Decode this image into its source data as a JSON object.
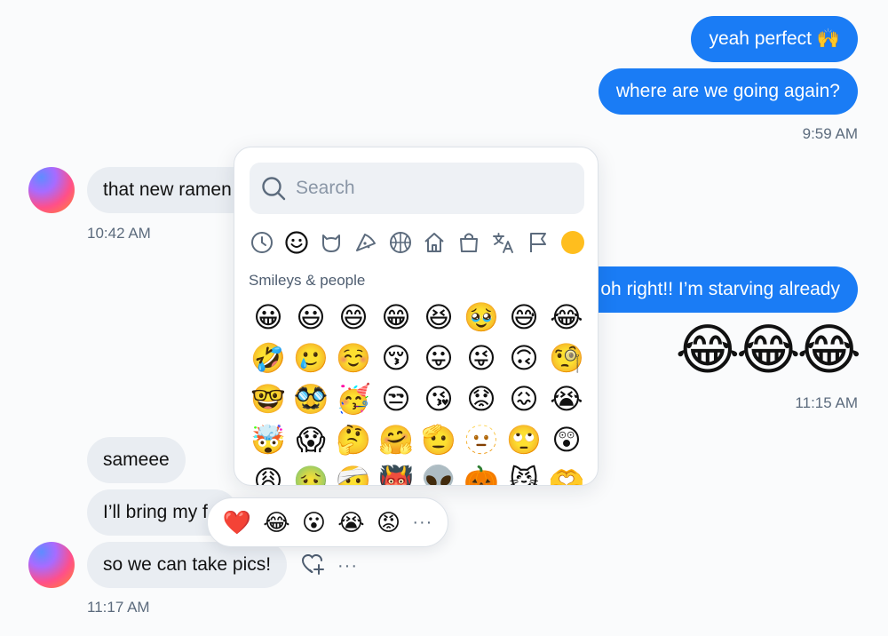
{
  "messages": {
    "out_1": "yeah perfect 🙌",
    "out_2": "where are we going again?",
    "ts_1": "9:59 AM",
    "in_1": "that new ramen",
    "ts_2": "10:42 AM",
    "out_3": "oh right!! I’m starving already",
    "out_4_emoji": "😂😂😂",
    "ts_3": "11:15 AM",
    "in_2": "sameee",
    "in_3": "I’ll bring my f",
    "in_4": "so we can take pics!",
    "ts_4": "11:17 AM"
  },
  "picker": {
    "search_placeholder": "Search",
    "section_label": "Smileys & people",
    "categories": [
      "clock-icon",
      "smiley-icon",
      "cat-icon",
      "pizza-icon",
      "ball-icon",
      "house-icon",
      "bag-icon",
      "translate-icon",
      "flag-icon",
      "skin-tone-icon"
    ],
    "emojis": [
      "😀",
      "😃",
      "😄",
      "😁",
      "😆",
      "🥹",
      "😅",
      "😂",
      "🤣",
      "🥲",
      "☺️",
      "😚",
      "😛",
      "😜",
      "🙃",
      "🧐",
      "🤓",
      "🥸",
      "🥳",
      "😒",
      "😘",
      "😟",
      "😖",
      "😭",
      "🤯",
      "😱",
      "🤔",
      "🤗",
      "🫡",
      "🫥",
      "🙄",
      "😲",
      "😩",
      "🤢",
      "🤕",
      "👹",
      "👽",
      "🎃",
      "😼",
      "🫶"
    ]
  },
  "reactions": {
    "items": [
      "❤️",
      "😂",
      "😮",
      "😭",
      "😡"
    ],
    "more": "···"
  },
  "side_actions": {
    "more": "···"
  },
  "colors": {
    "outgoing_bubble": "#1a7cf5",
    "incoming_bubble": "#e9edf2",
    "timestamp": "#5c6b7d"
  }
}
